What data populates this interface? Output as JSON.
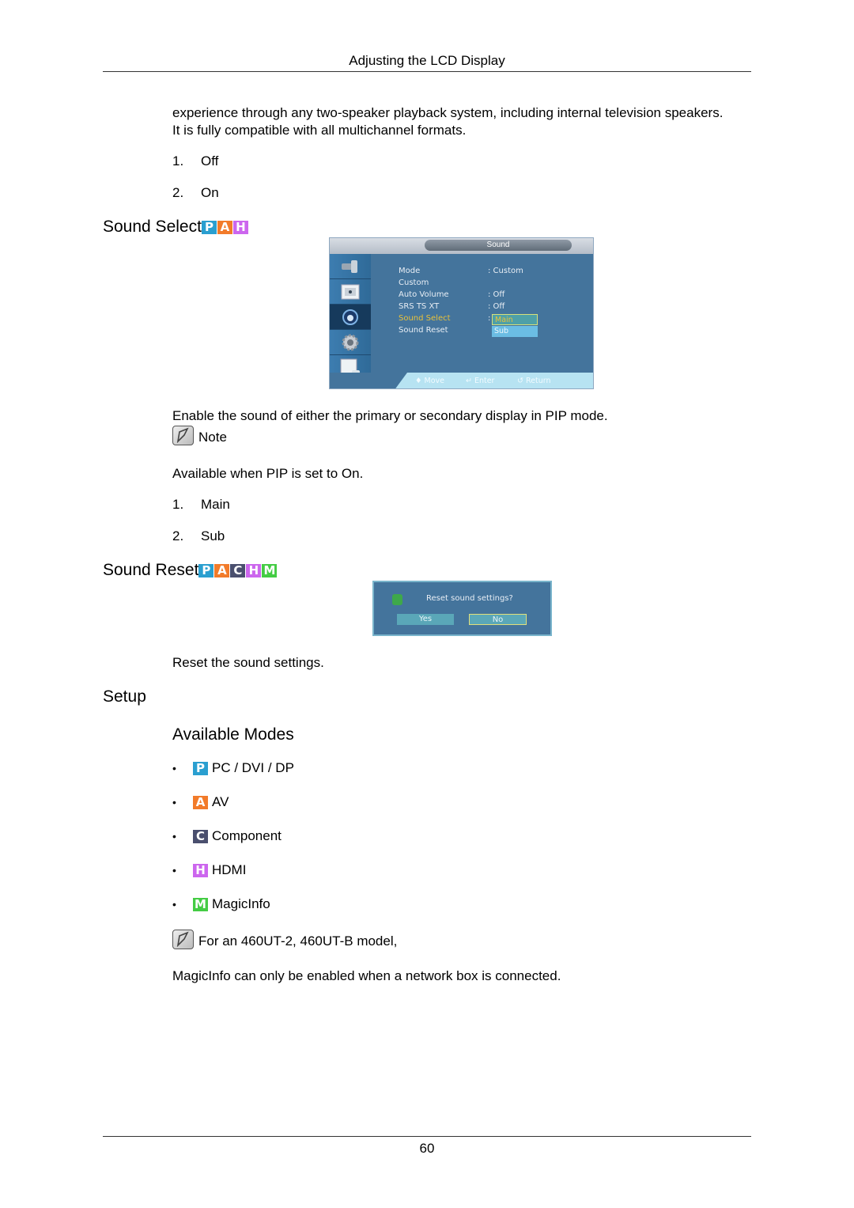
{
  "header": {
    "title": "Adjusting the LCD Display"
  },
  "intro": {
    "line1": "experience through any two-speaker playback system, including internal television speakers.",
    "line2": "It is fully compatible with all multichannel formats.",
    "options": [
      {
        "num": "1.",
        "label": "Off"
      },
      {
        "num": "2.",
        "label": "On"
      }
    ]
  },
  "sound_select": {
    "heading": "Sound Select",
    "badges": [
      {
        "letter": "P",
        "color": "#2a9fd0"
      },
      {
        "letter": "A",
        "color": "#f27b2a"
      },
      {
        "letter": "H",
        "color": "#cc66ee"
      }
    ],
    "osd": {
      "title": "Sound",
      "sidebar_icons": [
        "picture-settings-icon",
        "image-icon",
        "sound-icon",
        "setup-gear-icon",
        "multi-screen-icon"
      ],
      "active_tab": 2,
      "rows": [
        {
          "label": "Mode",
          "value": ": Custom"
        },
        {
          "label": "Custom",
          "value": ""
        },
        {
          "label": "Auto Volume",
          "value": ": Off"
        },
        {
          "label": "SRS TS XT",
          "value": ": Off"
        },
        {
          "label": "Sound Select",
          "value": ":"
        },
        {
          "label": "Sound Reset",
          "value": ""
        }
      ],
      "selected_row": "Sound Select",
      "dropdown": [
        {
          "label": "Main",
          "selected": true
        },
        {
          "label": "Sub",
          "selected": false
        }
      ],
      "footer": {
        "move": "Move",
        "enter": "Enter",
        "return": "Return"
      },
      "colors": {
        "panel": "#44749c",
        "highlight": "#e8c13a",
        "footer": "#b7e3f2"
      }
    },
    "description": "Enable the sound of either the primary or secondary display in PIP mode.",
    "note_label": "Note",
    "note_text": "Available when PIP is set to On.",
    "options": [
      {
        "num": "1.",
        "label": "Main"
      },
      {
        "num": "2.",
        "label": "Sub"
      }
    ]
  },
  "sound_reset": {
    "heading": "Sound Reset",
    "badges": [
      {
        "letter": "P",
        "color": "#2a9fd0"
      },
      {
        "letter": "A",
        "color": "#f27b2a"
      },
      {
        "letter": "C",
        "color": "#4a4f6e"
      },
      {
        "letter": "H",
        "color": "#cc66ee"
      },
      {
        "letter": "M",
        "color": "#44cc44"
      }
    ],
    "dialog": {
      "message": "Reset sound settings?",
      "yes": "Yes",
      "no": "No",
      "focused": "No"
    },
    "description": "Reset the sound settings."
  },
  "setup": {
    "heading": "Setup",
    "subheading": "Available Modes",
    "modes": [
      {
        "letter": "P",
        "color": "#2a9fd0",
        "label": "PC / DVI / DP"
      },
      {
        "letter": "A",
        "color": "#f27b2a",
        "label": "AV"
      },
      {
        "letter": "C",
        "color": "#4a4f6e",
        "label": "Component"
      },
      {
        "letter": "H",
        "color": "#cc66ee",
        "label": "HDMI"
      },
      {
        "letter": "M",
        "color": "#44cc44",
        "label": "MagicInfo"
      }
    ],
    "note_label": "For an 460UT-2, 460UT-B model,",
    "note_text_bold": "MagicInfo",
    "note_text_rest": " can only be enabled when a network box is connected."
  },
  "footer": {
    "page_number": "60"
  }
}
